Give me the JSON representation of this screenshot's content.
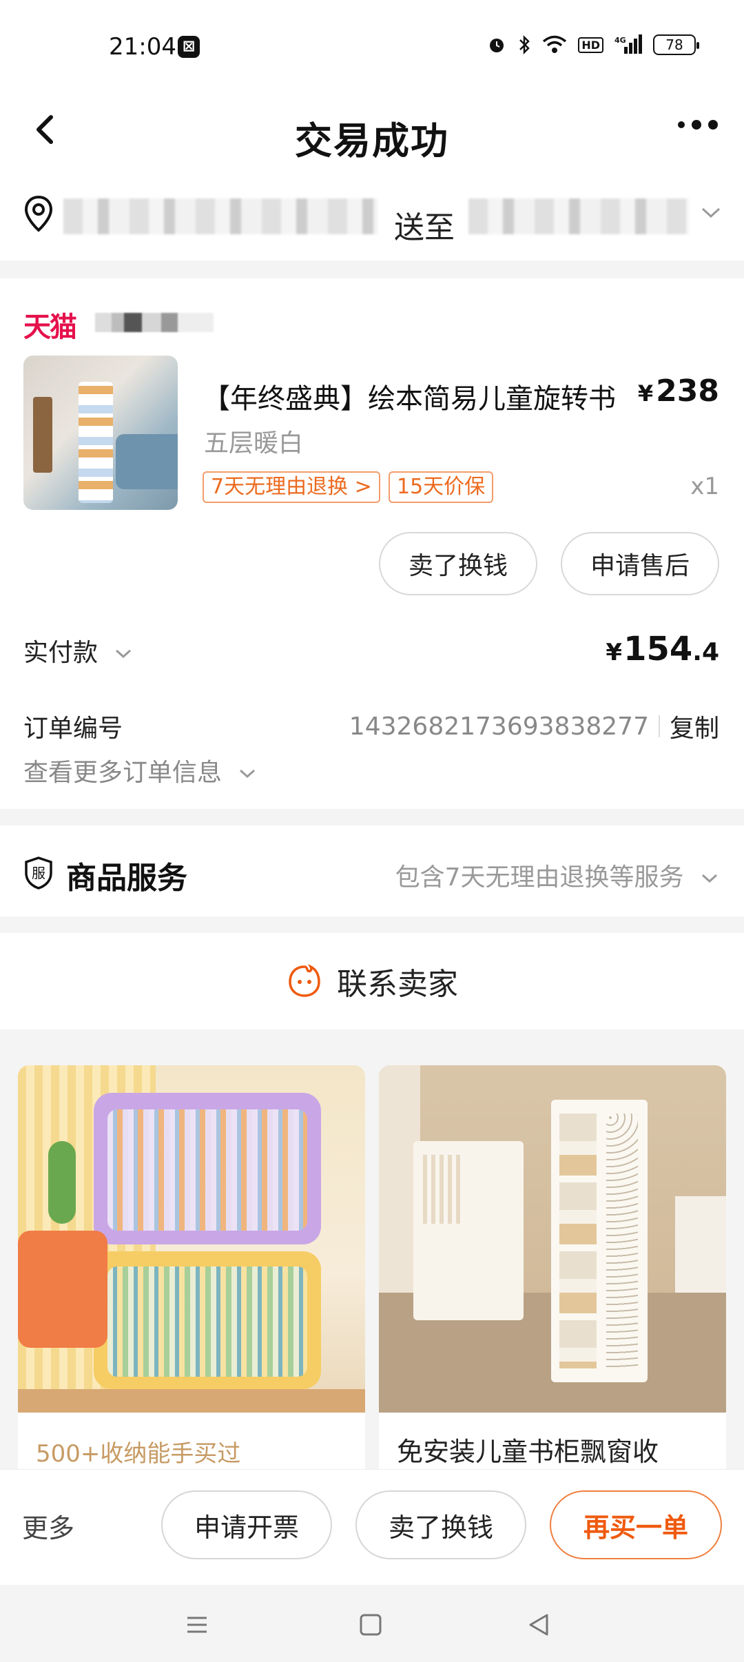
{
  "status_bar": {
    "time": "21:04",
    "app_glyph": "⊠",
    "network": "4G",
    "hd": "HD",
    "battery": "78"
  },
  "header": {
    "title": "交易成功"
  },
  "address": {
    "deliver_label": "送至"
  },
  "order": {
    "shop_label": "天猫",
    "product_name": "【年终盛典】绘本简易儿童旋转书",
    "price_symbol": "¥",
    "price": "238",
    "spec": "五层暖白",
    "badges": [
      "7天无理由退换 >",
      "15天价保"
    ],
    "quantity": "x1",
    "item_actions": [
      "卖了换钱",
      "申请售后"
    ],
    "paid_label": "实付款",
    "paid_symbol": "¥",
    "paid_int": "154",
    "paid_dec": ".4",
    "order_no_label": "订单编号",
    "order_no": "1432682173693838277",
    "copy_label": "复制",
    "more_info_label": "查看更多订单信息"
  },
  "service": {
    "icon_text": "服",
    "title": "商品服务",
    "desc": "包含7天无理由退换等服务"
  },
  "contact": {
    "label": "联系卖家"
  },
  "recommendations": [
    {
      "title": "500+收纳能手买过"
    },
    {
      "title": "免安装儿童书柜飘窗收"
    }
  ],
  "action_bar": {
    "more_label": "更多",
    "buttons": [
      "申请开票",
      "卖了换钱",
      "再买一单"
    ]
  },
  "colors": {
    "accent": "#ef5a0f",
    "tmall": "#e5114c",
    "badge": "#ec6a1f"
  },
  "icons": [
    "back-arrow-icon",
    "more-dots-icon",
    "location-pin-icon",
    "chevron-down-icon",
    "service-shield-icon",
    "seller-face-icon",
    "nav-menu-icon",
    "nav-home-icon",
    "nav-back-icon"
  ]
}
